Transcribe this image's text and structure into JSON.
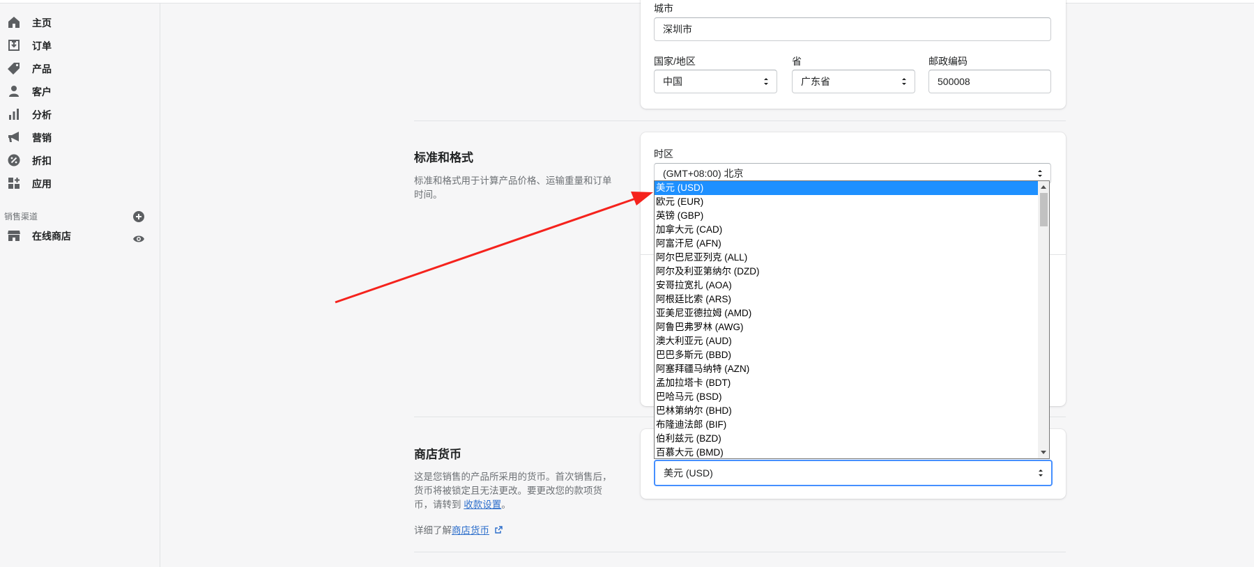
{
  "sidebar": {
    "items": [
      {
        "label": "主页",
        "icon": "home-icon"
      },
      {
        "label": "订单",
        "icon": "orders-icon"
      },
      {
        "label": "产品",
        "icon": "tag-icon"
      },
      {
        "label": "客户",
        "icon": "person-icon"
      },
      {
        "label": "分析",
        "icon": "bar-chart-icon"
      },
      {
        "label": "营销",
        "icon": "megaphone-icon"
      },
      {
        "label": "折扣",
        "icon": "discount-icon"
      },
      {
        "label": "应用",
        "icon": "apps-icon"
      }
    ],
    "channels_title": "销售渠道",
    "online_store": "在线商店"
  },
  "address": {
    "city_label": "城市",
    "city_value": "深圳市",
    "country_label": "国家/地区",
    "country_value": "中国",
    "province_label": "省",
    "province_value": "广东省",
    "postal_label": "邮政编码",
    "postal_value": "500008"
  },
  "standards": {
    "heading": "标准和格式",
    "description": "标准和格式用于计算产品价格、运输重量和订单时间。",
    "timezone_label": "时区",
    "timezone_value": "(GMT+08:00) 北京"
  },
  "currency": {
    "heading": "商店货币",
    "description_prefix": "这是您销售的产品所采用的货币。首次销售后，货币将被锁定且无法更改。要更改您的款项货币，请转到",
    "settings_link": "收款设置",
    "description_suffix": "。",
    "learn_prefix": "详细了解",
    "learn_link": "商店货币",
    "value": "美元 (USD)"
  },
  "currency_options": [
    "美元 (USD)",
    "欧元 (EUR)",
    "英镑 (GBP)",
    "加拿大元 (CAD)",
    "阿富汗尼 (AFN)",
    "阿尔巴尼亚列克 (ALL)",
    "阿尔及利亚第纳尔 (DZD)",
    "安哥拉宽扎 (AOA)",
    "阿根廷比索 (ARS)",
    "亚美尼亚德拉姆 (AMD)",
    "阿鲁巴弗罗林 (AWG)",
    "澳大利亚元 (AUD)",
    "巴巴多斯元 (BBD)",
    "阿塞拜疆马纳特 (AZN)",
    "孟加拉塔卡 (BDT)",
    "巴哈马元 (BSD)",
    "巴林第纳尔 (BHD)",
    "布隆迪法郎 (BIF)",
    "伯利兹元 (BZD)",
    "百慕大元 (BMD)"
  ],
  "colors": {
    "accent": "#1e90ff",
    "annotation_arrow": "#f5231d",
    "link": "#2c6ecb"
  }
}
